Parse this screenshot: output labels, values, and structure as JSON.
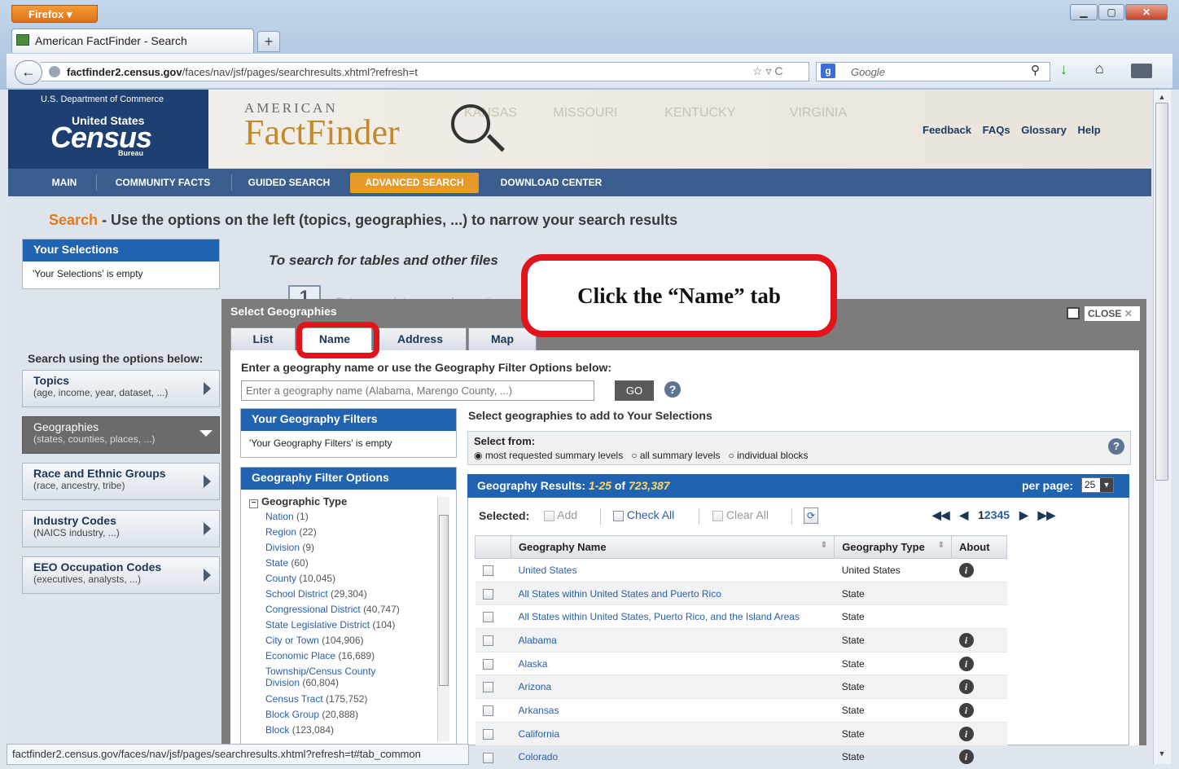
{
  "browser": {
    "menu_label": "Firefox",
    "tab_title": "American FactFinder - Search",
    "url_domain": "factfinder2.census.gov",
    "url_path": "/faces/nav/jsf/pages/searchresults.xhtml?refresh=t",
    "search_placeholder": "Google",
    "status_url": "factfinder2.census.gov/faces/nav/jsf/pages/searchresults.xhtml?refresh=t#tab_common"
  },
  "header": {
    "dept": "U.S. Department of Commerce",
    "logo_us": "United States",
    "logo_census": "Census",
    "logo_bureau": "Bureau",
    "brand_small": "AMERICAN",
    "brand_big": "FactFinder",
    "links": [
      "Feedback",
      "FAQs",
      "Glossary",
      "Help"
    ]
  },
  "nav": [
    "MAIN",
    "COMMUNITY FACTS",
    "GUIDED SEARCH",
    "ADVANCED SEARCH",
    "DOWNLOAD CENTER"
  ],
  "page": {
    "search_word": "Search",
    "search_text": "- Use the options on the left (topics, geographies, ...) to narrow your search results",
    "tables_text": "To search for tables and other files",
    "step": "1",
    "step_text": "Enter search terms and an opti"
  },
  "your_selections": {
    "title": "Your Selections",
    "empty": "'Your Selections' is empty"
  },
  "left": {
    "heading": "Search using the options below:",
    "items": [
      {
        "title": "Topics",
        "sub": "(age, income, year, dataset, ...)"
      },
      {
        "title": "Geographies",
        "sub": "(states, counties, places, ...)"
      },
      {
        "title": "Race and Ethnic Groups",
        "sub": "(race, ancestry, tribe)"
      },
      {
        "title": "Industry Codes",
        "sub": "(NAICS industry, ...)"
      },
      {
        "title": "EEO Occupation Codes",
        "sub": "(executives, analysts, ...)"
      }
    ]
  },
  "dialog": {
    "title": "Select Geographies",
    "close": "CLOSE",
    "tabs": [
      "List",
      "Name",
      "Address",
      "Map"
    ],
    "prompt": "Enter a geography name or use the Geography Filter Options below:",
    "input_placeholder": "Enter a geography name (Alabama, Marengo County, ...)",
    "go": "GO",
    "filters_title": "Your Geography Filters",
    "filters_empty": "'Your Geography Filters' is empty",
    "options_title": "Geography Filter Options",
    "geo_type": "Geographic Type",
    "geo_types": [
      [
        "Nation",
        "(1)"
      ],
      [
        "Region",
        "(22)"
      ],
      [
        "Division",
        "(9)"
      ],
      [
        "State",
        "(60)"
      ],
      [
        "County",
        "(10,045)"
      ],
      [
        "School District",
        "(29,304)"
      ],
      [
        "Congressional District",
        "(40,747)"
      ],
      [
        "State Legislative District",
        "(104)"
      ],
      [
        "City or Town",
        "(104,906)"
      ],
      [
        "Economic Place",
        "(16,689)"
      ],
      [
        "Township/Census County Division",
        "(60,804)"
      ],
      [
        "Census Tract",
        "(175,752)"
      ],
      [
        "Block Group",
        "(20,888)"
      ],
      [
        "Block",
        "(123,084)"
      ]
    ],
    "select_heading": "Select geographies to add to Your Selections",
    "select_from": "Select from:",
    "radio": [
      "most requested summary levels",
      "all summary levels",
      "individual blocks"
    ],
    "results_label": "Geography Results:",
    "results_range": "1-25",
    "results_of": "of",
    "results_total": "723,387",
    "per_page_label": "per page:",
    "per_page": "25",
    "toolbar": {
      "selected": "Selected:",
      "add": "Add",
      "check_all": "Check All",
      "clear_all": "Clear All"
    },
    "pages": [
      "1",
      "2",
      "3",
      "4",
      "5"
    ],
    "columns": [
      "Geography Name",
      "Geography Type",
      "About"
    ],
    "rows": [
      [
        "United States",
        "United States",
        true
      ],
      [
        "All States within United States and Puerto Rico",
        "State",
        false
      ],
      [
        "All States within United States, Puerto Rico, and the Island Areas",
        "State",
        false
      ],
      [
        "Alabama",
        "State",
        true
      ],
      [
        "Alaska",
        "State",
        true
      ],
      [
        "Arizona",
        "State",
        true
      ],
      [
        "Arkansas",
        "State",
        true
      ],
      [
        "California",
        "State",
        true
      ],
      [
        "Colorado",
        "State",
        true
      ]
    ]
  },
  "callout": "Click the “Name” tab",
  "colors": {
    "accent": "#e47a1a",
    "blue": "#1f63b1",
    "callout_red": "#e2141b"
  }
}
